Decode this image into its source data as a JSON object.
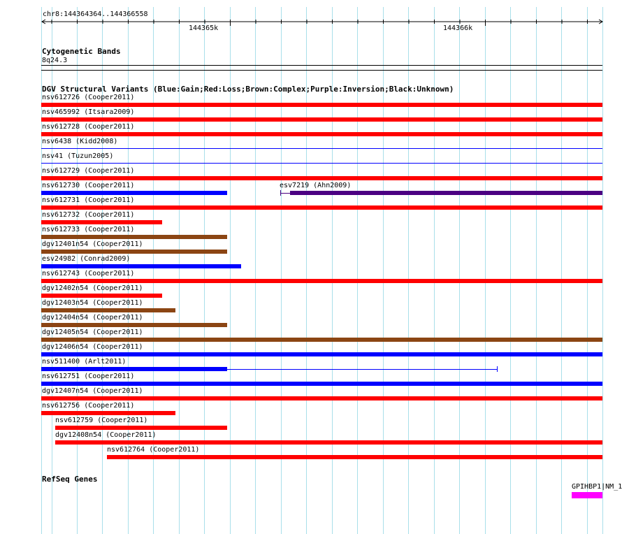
{
  "colors": {
    "grid": "#a9dfea",
    "gain": "#0000ff",
    "loss": "#ff0000",
    "complex": "#8b4513",
    "inversion": "#4b0082",
    "gene": "#ff00ff"
  },
  "ruler": {
    "region": "chr8:144364364..144366558",
    "tick_labels": [
      "144365k",
      "144366k"
    ]
  },
  "cytogenetic": {
    "title": "Cytogenetic Bands",
    "band": "8q24.3"
  },
  "dgv": {
    "title": "DGV Structural Variants (Blue:Gain;Red:Loss;Brown:Complex;Purple:Inversion;Black:Unknown)",
    "variants": [
      {
        "label": "nsv612726 (Cooper2011)",
        "type": "loss"
      },
      {
        "label": "nsv465992 (Itsara2009)",
        "type": "loss"
      },
      {
        "label": "nsv612728 (Cooper2011)",
        "type": "loss"
      },
      {
        "label": "nsv6438 (Kidd2008)",
        "type": "gain"
      },
      {
        "label": "nsv41 (Tuzun2005)",
        "type": "gain"
      },
      {
        "label": "nsv612729 (Cooper2011)",
        "type": "loss"
      },
      {
        "label": "nsv612730 (Cooper2011)",
        "type": "gain"
      },
      {
        "label": "esv7219 (Ahn2009)",
        "type": "inversion"
      },
      {
        "label": "nsv612731 (Cooper2011)",
        "type": "loss"
      },
      {
        "label": "nsv612732 (Cooper2011)",
        "type": "loss"
      },
      {
        "label": "nsv612733 (Cooper2011)",
        "type": "complex"
      },
      {
        "label": "dgv12401n54 (Cooper2011)",
        "type": "complex"
      },
      {
        "label": "esv24982 (Conrad2009)",
        "type": "gain"
      },
      {
        "label": "nsv612743 (Cooper2011)",
        "type": "loss"
      },
      {
        "label": "dgv12402n54 (Cooper2011)",
        "type": "loss"
      },
      {
        "label": "dgv12403n54 (Cooper2011)",
        "type": "complex"
      },
      {
        "label": "dgv12404n54 (Cooper2011)",
        "type": "complex"
      },
      {
        "label": "dgv12405n54 (Cooper2011)",
        "type": "complex"
      },
      {
        "label": "dgv12406n54 (Cooper2011)",
        "type": "gain"
      },
      {
        "label": "nsv511400 (Arlt2011)",
        "type": "gain"
      },
      {
        "label": "nsv612751 (Cooper2011)",
        "type": "gain"
      },
      {
        "label": "dgv12407n54 (Cooper2011)",
        "type": "loss"
      },
      {
        "label": "nsv612756 (Cooper2011)",
        "type": "loss"
      },
      {
        "label": "nsv612759 (Cooper2011)",
        "type": "loss"
      },
      {
        "label": "dgv12408n54 (Cooper2011)",
        "type": "loss"
      },
      {
        "label": "nsv612764 (Cooper2011)",
        "type": "loss"
      }
    ]
  },
  "refseq": {
    "title": "RefSeq Genes",
    "gene_label": "GPIHBP1|NM_1"
  }
}
